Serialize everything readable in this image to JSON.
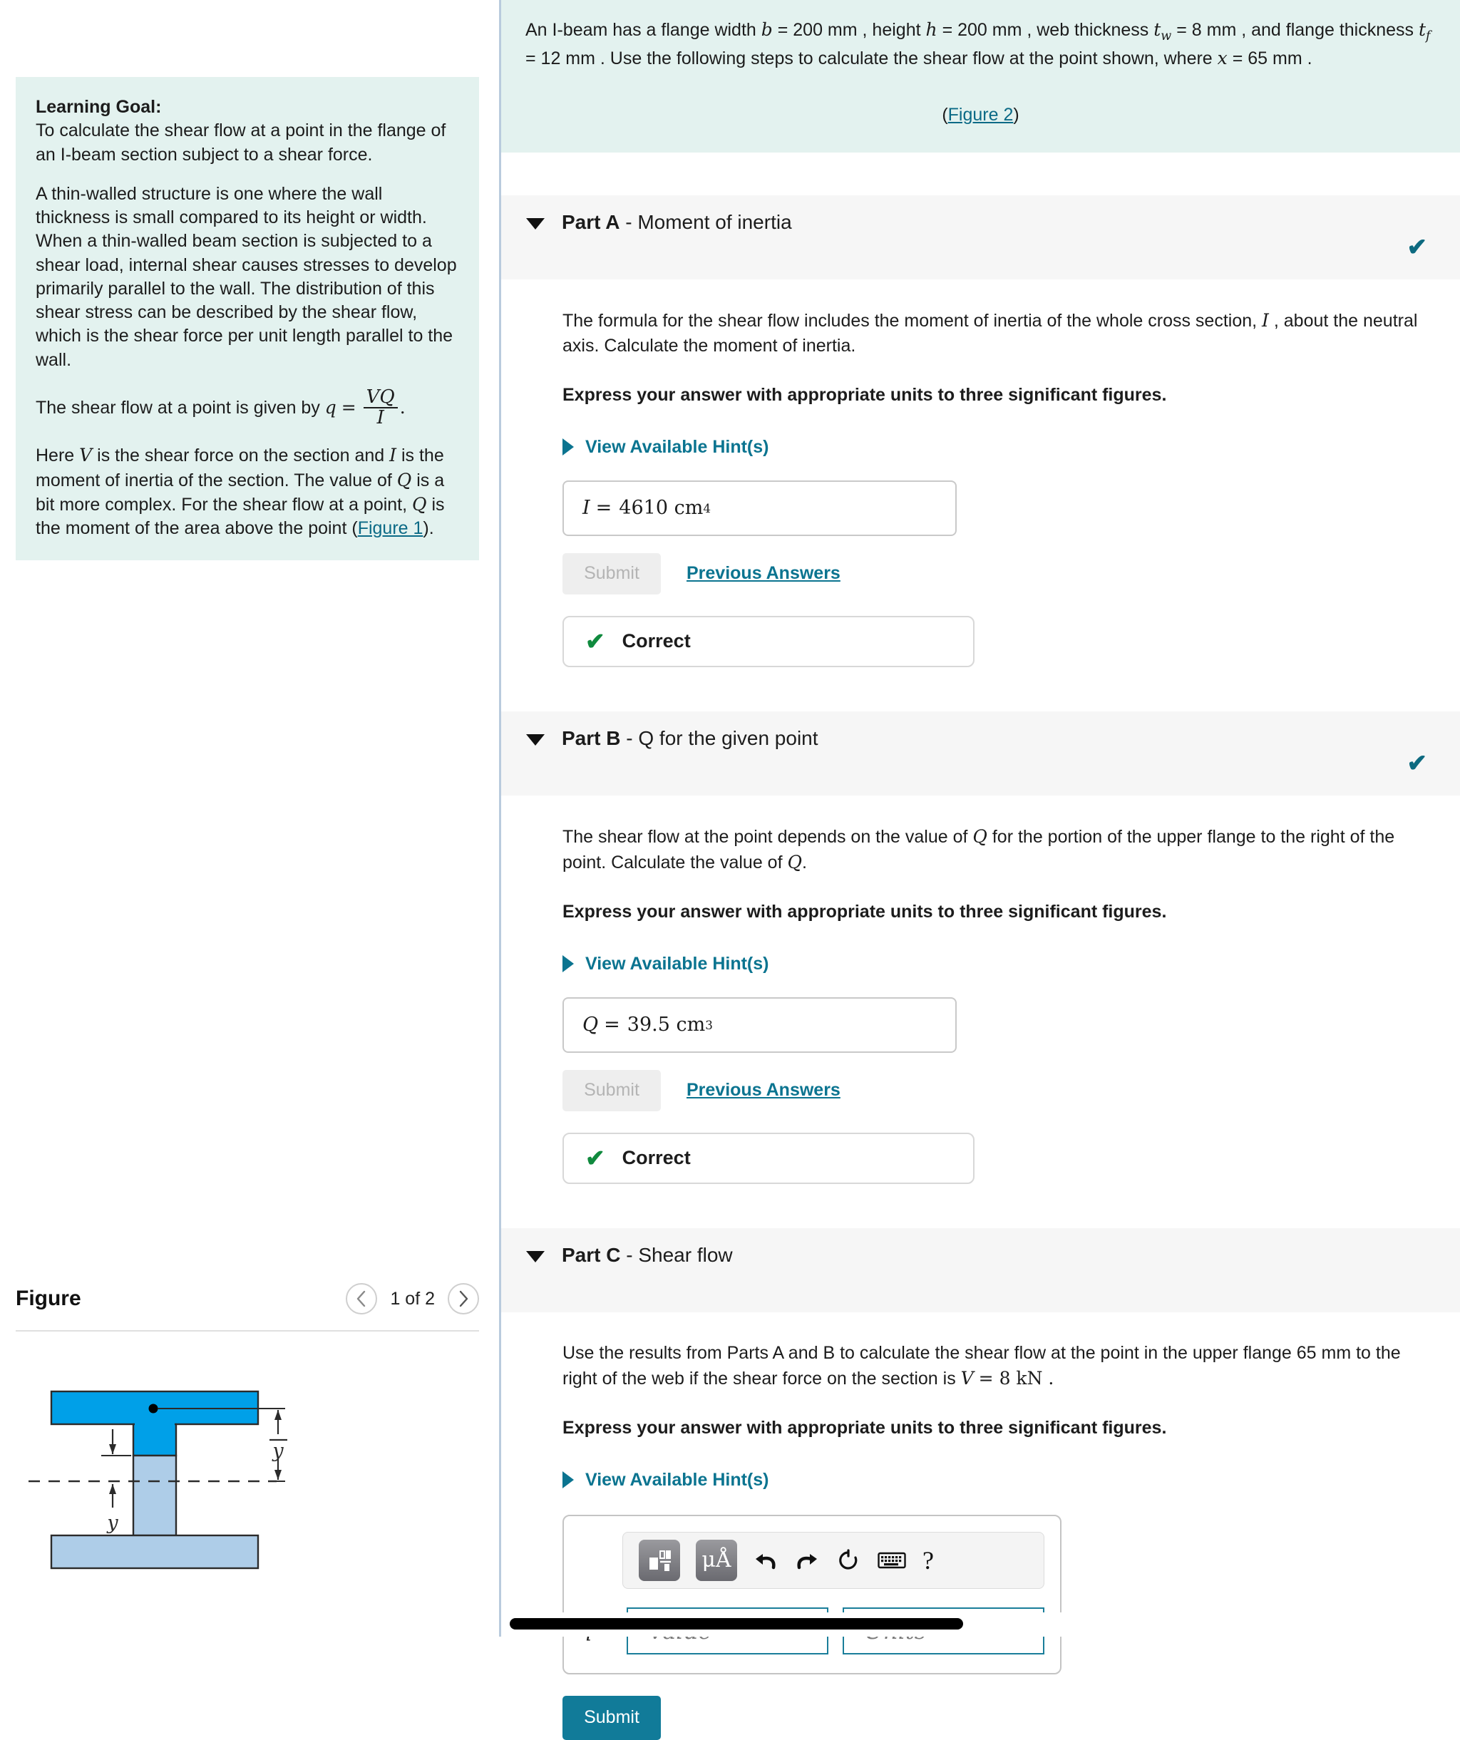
{
  "left": {
    "goal": {
      "title": "Learning Goal:",
      "p1": "To calculate the shear flow at a point in the flange of an I-beam section subject to a shear force.",
      "p2": "A thin-walled structure is one where the wall thickness is small compared to its height or width. When a thin-walled beam section is subjected to a shear load, internal shear causes stresses to develop primarily parallel to the wall. The distribution of this shear stress can be described by the shear flow, which is the shear force per unit length parallel to the wall.",
      "p3_lead": "The shear flow at a point is given by",
      "p3_q": "q",
      "p3_eq": "=",
      "p3_num": "VQ",
      "p3_den": "I",
      "p3_period": ".",
      "p4_a": "Here",
      "p4_V": "V",
      "p4_b": "is the shear force on the section and",
      "p4_I": "I",
      "p4_c": "is the moment of inertia of the section. The value of",
      "p4_Q1": "Q",
      "p4_d": "is a bit more complex. For the shear flow at a point,",
      "p4_Q2": "Q",
      "p4_e": "is the moment of the area above the point (",
      "p4_link": "Figure 1",
      "p4_f": ")."
    },
    "figure": {
      "title": "Figure",
      "count": "1 of 2",
      "prev_icon": "chevron-left-icon",
      "next_icon": "chevron-right-icon",
      "label_y_top": "y",
      "label_y_bottom": "y",
      "colors": {
        "upper_flange": "#00a0e8",
        "lower_part": "#aecde8",
        "outline": "#2b2b2b"
      }
    }
  },
  "right": {
    "question": {
      "t1": "An I-beam has a flange width",
      "b": "b",
      "t2": "= 200 mm , height",
      "h": "h",
      "t3": "= 200 mm , web thickness",
      "tw": "t",
      "tw_sub": "w",
      "t4": "= 8 mm , and flange thickness",
      "tf": "t",
      "tf_sub": "f",
      "t5": "= 12 mm . Use the following steps to calculate the shear flow at the point shown, where",
      "x": "x",
      "t6": "= 65 mm .",
      "figure_link_open": "(",
      "figure_link": "Figure 2",
      "figure_link_close": ")"
    },
    "parts": [
      {
        "id": "A",
        "label_bold": "Part A",
        "label_dash": "-",
        "label_rest": "Moment of inertia",
        "caret_icon": "caret-down-icon",
        "check_icon": "check-icon",
        "desc_a": "The formula for the shear flow includes the moment of inertia of the whole cross section,",
        "desc_sym": "I",
        "desc_b": ", about the neutral axis. Calculate the moment of inertia.",
        "express": "Express your answer with appropriate units to three significant figures.",
        "hints": "View Available Hint(s)",
        "answer_symbol": "I",
        "answer_eq": "=",
        "answer_value": "4610 cm",
        "answer_exp": "4",
        "submit_label": "Submit",
        "previous_label": "Previous Answers",
        "status_icon": "check-icon",
        "status_label": "Correct"
      },
      {
        "id": "B",
        "label_bold": "Part B",
        "label_dash": "-",
        "label_rest": "Q for the given point",
        "caret_icon": "caret-down-icon",
        "check_icon": "check-icon",
        "desc_a": "The shear flow at the point depends on the value of",
        "desc_sym": "Q",
        "desc_b": "for the portion of the upper flange to the right of the point. Calculate the value of",
        "desc_sym2": "Q",
        "desc_c": ".",
        "express": "Express your answer with appropriate units to three significant figures.",
        "hints": "View Available Hint(s)",
        "answer_symbol": "Q",
        "answer_eq": "=",
        "answer_value": "39.5 cm",
        "answer_exp": "3",
        "submit_label": "Submit",
        "previous_label": "Previous Answers",
        "status_icon": "check-icon",
        "status_label": "Correct"
      },
      {
        "id": "C",
        "label_bold": "Part C",
        "label_dash": "-",
        "label_rest": "Shear flow",
        "caret_icon": "caret-down-icon",
        "desc_a": "Use the results from Parts A and B to calculate the shear flow at the point in the upper flange 65 mm to the right of the web if the shear force on the section is",
        "desc_sym": "V",
        "desc_b": "= 8 kN .",
        "express": "Express your answer with appropriate units to three significant figures.",
        "hints": "View Available Hint(s)",
        "entry_symbol": "q =",
        "value_placeholder": "Value",
        "units_placeholder": "Units",
        "submit_label": "Submit",
        "toolbar": [
          {
            "name": "template-icon",
            "glyph": ""
          },
          {
            "name": "units-icon",
            "glyph": "μÅ"
          },
          {
            "name": "undo-icon",
            "glyph": "↶"
          },
          {
            "name": "redo-icon",
            "glyph": "↷"
          },
          {
            "name": "reset-icon",
            "glyph": "↻"
          },
          {
            "name": "keyboard-icon",
            "glyph": "⌨"
          },
          {
            "name": "help-icon",
            "glyph": "?"
          }
        ]
      }
    ]
  },
  "scrollbar": {
    "name": "horizontal-scrollbar"
  },
  "colors": {
    "accent_teal": "#117b99",
    "link_teal": "#0b7490",
    "correct_green": "#108a3e",
    "info_bg": "#e3f2ef",
    "part_header_bg": "#f6f6f6"
  }
}
